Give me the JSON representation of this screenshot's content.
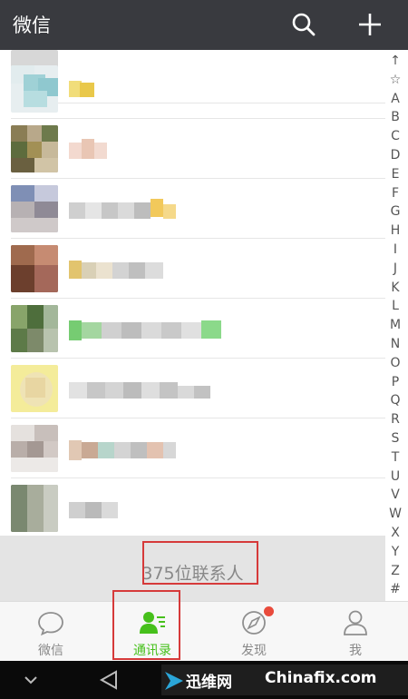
{
  "header": {
    "title": "微信",
    "icons": [
      "search-icon",
      "plus-icon"
    ]
  },
  "index": [
    "↑",
    "☆",
    "A",
    "B",
    "C",
    "D",
    "E",
    "F",
    "G",
    "H",
    "I",
    "J",
    "K",
    "L",
    "M",
    "N",
    "O",
    "P",
    "Q",
    "R",
    "S",
    "T",
    "U",
    "V",
    "W",
    "X",
    "Y",
    "Z",
    "#"
  ],
  "footer": {
    "count": "375位联系人"
  },
  "tabs": [
    {
      "label": "微信",
      "icon": "chat-bubble-icon"
    },
    {
      "label": "通讯录",
      "icon": "contacts-icon"
    },
    {
      "label": "发现",
      "icon": "compass-icon"
    },
    {
      "label": "我",
      "icon": "person-icon"
    }
  ],
  "watermark": {
    "brand": "迅维网",
    "site": "Chinafix.com"
  },
  "colors": {
    "header_bg": "#393a3f",
    "accent": "#46c01b",
    "highlight": "#d63a3a",
    "badge": "#e94b3c"
  }
}
